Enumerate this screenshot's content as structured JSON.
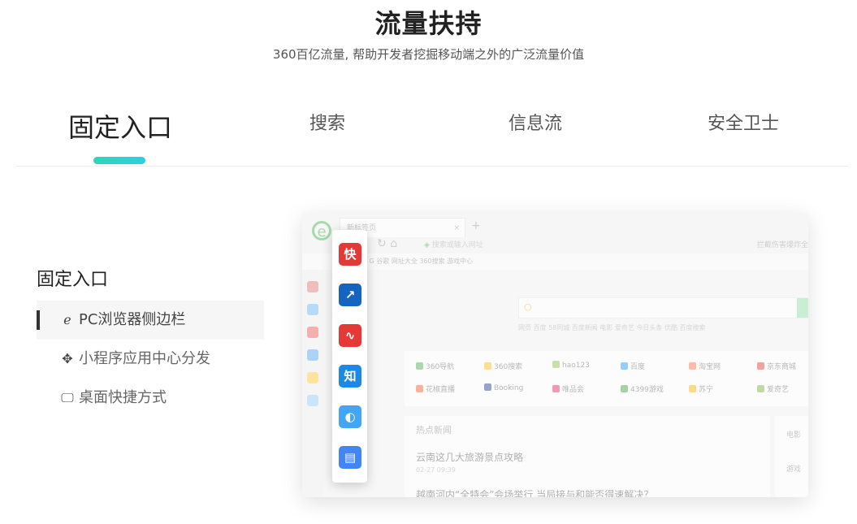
{
  "header": {
    "title": "流量扶持",
    "subtitle": "360百亿流量, 帮助开发者挖掘移动端之外的广泛流量价值"
  },
  "tabs": [
    {
      "label": "固定入口",
      "active": true
    },
    {
      "label": "搜索",
      "active": false
    },
    {
      "label": "信息流",
      "active": false
    },
    {
      "label": "安全卫士",
      "active": false
    }
  ],
  "section": {
    "title": "固定入口",
    "items": [
      {
        "label": "PC浏览器侧边栏",
        "icon": "ie-browser-icon",
        "active": true
      },
      {
        "label": "小程序应用中心分发",
        "icon": "app-center-icon",
        "active": false
      },
      {
        "label": "桌面快捷方式",
        "icon": "desktop-icon",
        "active": false
      }
    ]
  },
  "browser": {
    "tab_title": "新标签页",
    "tab_close": "×",
    "new_tab": "+",
    "address_placeholder": "搜索或输入网址",
    "toolbar_right": "拦截伤害爆炸全",
    "bookmarks": "手机收藏夹  G 谷歌  网址大全  360搜索  游戏中心",
    "search_links": "网页  百度  58同城  百度新闻  电影  爱奇艺  今日头条  优酷  百度搜索",
    "sites": [
      {
        "label": "360导航",
        "color": "#4caf50"
      },
      {
        "label": "360搜索",
        "color": "#ffc107"
      },
      {
        "label": "hao123",
        "color": "#8bc34a"
      },
      {
        "label": "百度",
        "color": "#2196f3"
      },
      {
        "label": "淘宝网",
        "color": "#ff7043"
      },
      {
        "label": "京东商城",
        "color": "#e53935"
      },
      {
        "label": "花椒直播",
        "color": "#ff5722"
      },
      {
        "label": "Booking",
        "color": "#1e3a8a"
      },
      {
        "label": "唯品会",
        "color": "#e91e63"
      },
      {
        "label": "4399游戏",
        "color": "#43a047"
      },
      {
        "label": "苏宁",
        "color": "#ffb300"
      },
      {
        "label": "爱奇艺",
        "color": "#7cb342"
      }
    ],
    "news_title": "热点新闻",
    "news_headline": "云南这几大旅游景点攻略",
    "news_date": "02-27  09:39",
    "news_headline_2": "越南河内“全特会”会场举行 当局接与和能否得速解决？",
    "side_panel": [
      "电影",
      "游戏"
    ]
  },
  "popup_icons": [
    {
      "name": "kuai-app-icon",
      "glyph": "快",
      "color": "#e53935"
    },
    {
      "name": "stock-app-icon",
      "glyph": "↗",
      "color": "#1565c0"
    },
    {
      "name": "chart-app-icon",
      "glyph": "∿",
      "color": "#e53935"
    },
    {
      "name": "zhihu-app-icon",
      "glyph": "知",
      "color": "#1e88e5"
    },
    {
      "name": "browser-app-icon",
      "glyph": "◐",
      "color": "#42a5f5"
    },
    {
      "name": "doc-app-icon",
      "glyph": "▤",
      "color": "#4285f4"
    }
  ],
  "colors": {
    "accent": "#2ed6b5",
    "accent_end": "#2bd2e0"
  }
}
